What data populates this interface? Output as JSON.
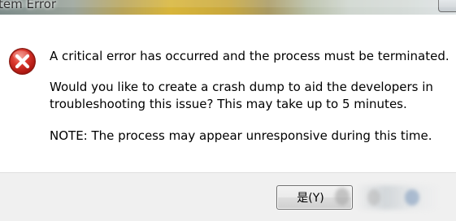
{
  "window": {
    "title": "tem Error"
  },
  "dialog": {
    "icon": "error-icon",
    "message_main": "A critical error has occurred and the process must be terminated.",
    "message_question_line1": "Would you like to create a crash dump to aid the developers in",
    "message_question_line2": "troubleshooting this issue? This may take up to 5 minutes.",
    "message_note": "NOTE: The process may appear unresponsive during this time."
  },
  "buttons": {
    "yes_label": "是(Y)"
  },
  "colors": {
    "error_red": "#d42b22",
    "button_area": "#f0f0f0",
    "content_bg": "#ffffff"
  }
}
